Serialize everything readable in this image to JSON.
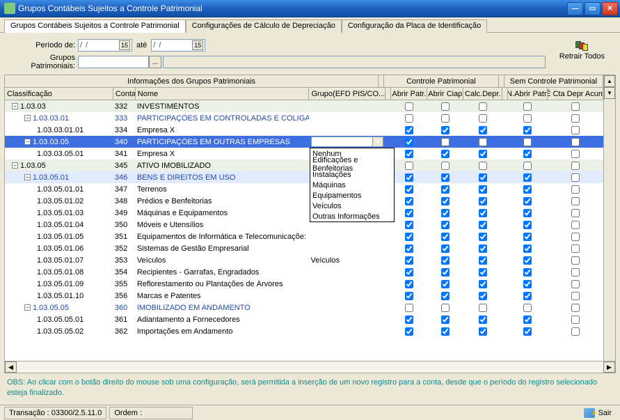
{
  "window": {
    "title": "Grupos Contábeis Sujeitos a Controle Patrimonial"
  },
  "tabs": [
    {
      "label": "Grupos Contábeis Sujeitos a Controle Patrimonial"
    },
    {
      "label": "Configurações de Cálculo de Depreciação"
    },
    {
      "label": "Configuração da Placa de Identificação"
    }
  ],
  "form": {
    "periodo_label": "Período de:",
    "ate_label": "até",
    "date_placeholder": "/  /",
    "grupos_label": "Grupos Patrimoniais:",
    "retrair_label": "Retrair Todos"
  },
  "headers1": {
    "info": "Informações dos Grupos Patrimoniais",
    "ctrl": "Controle Patrimonial",
    "sem": "Sem Controle Patrimonial"
  },
  "headers2": {
    "class": "Classificação",
    "conta": "Conta",
    "nome": "Nome",
    "grupo": "Grupo(EFD PIS/CO...",
    "abrir_patr": "Abrir Patr.",
    "abrir_ciap": "Abrir Ciap",
    "calc_depr": "Calc.Depr.",
    "nabrir": "N.Abrir Patr.",
    "ecta": "É Cta Depr Acum"
  },
  "dropdown_options": [
    "Nenhum",
    "Edificações e Benfeitorias",
    "Instalações",
    "Máquinas",
    "Equipamentos",
    "Veículos",
    "Outras Informações"
  ],
  "rows": [
    {
      "indent": 0,
      "toggle": "-",
      "class": "1.03.03",
      "conta": "332",
      "nome": "INVESTIMENTOS",
      "grupo": "",
      "ap": false,
      "ac": false,
      "cd": false,
      "na": false,
      "ec": false,
      "style": "greenish"
    },
    {
      "indent": 1,
      "toggle": "-",
      "class": "1.03.03.01",
      "conta": "333",
      "nome": "PARTICIPAÇÕES EM CONTROLADAS E COLIGA",
      "grupo": "",
      "ap": false,
      "ac": false,
      "cd": false,
      "na": false,
      "ec": false,
      "style": "header-blue"
    },
    {
      "indent": 2,
      "toggle": "",
      "class": "1.03.03.01.01",
      "conta": "334",
      "nome": "Empresa X",
      "grupo": "",
      "ap": true,
      "ac": true,
      "cd": true,
      "na": true,
      "ec": false,
      "style": ""
    },
    {
      "indent": 1,
      "toggle": "-",
      "class": "1.03.03.05",
      "conta": "340",
      "nome": "PARTICIPAÇÕES EM OUTRAS EMPRESAS",
      "grupo": "",
      "ap": true,
      "ac": false,
      "cd": false,
      "na": false,
      "ec": false,
      "style": "sel",
      "dd": true
    },
    {
      "indent": 2,
      "toggle": "",
      "class": "1.03.03.05.01",
      "conta": "341",
      "nome": "Empresa X",
      "grupo": "",
      "ap": true,
      "ac": true,
      "cd": true,
      "na": true,
      "ec": false,
      "style": ""
    },
    {
      "indent": 0,
      "toggle": "-",
      "class": "1.03.05",
      "conta": "345",
      "nome": "ATIVO IMOBILIZADO",
      "grupo": "",
      "ap": false,
      "ac": false,
      "cd": false,
      "na": false,
      "ec": false,
      "style": "greenish"
    },
    {
      "indent": 1,
      "toggle": "-",
      "class": "1.03.05.01",
      "conta": "346",
      "nome": "BENS E DIREITOS EM USO",
      "grupo": "",
      "ap": true,
      "ac": true,
      "cd": true,
      "na": true,
      "ec": false,
      "style": "blue"
    },
    {
      "indent": 2,
      "toggle": "",
      "class": "1.03.05.01.01",
      "conta": "347",
      "nome": "Terrenos",
      "grupo": "",
      "ap": true,
      "ac": true,
      "cd": true,
      "na": true,
      "ec": false,
      "style": ""
    },
    {
      "indent": 2,
      "toggle": "",
      "class": "1.03.05.01.02",
      "conta": "348",
      "nome": "Prédios e Benfeitorias",
      "grupo": "",
      "ap": true,
      "ac": true,
      "cd": true,
      "na": true,
      "ec": false,
      "style": ""
    },
    {
      "indent": 2,
      "toggle": "",
      "class": "1.03.05.01.03",
      "conta": "349",
      "nome": "Máquinas e Equipamentos",
      "grupo": "",
      "ap": true,
      "ac": true,
      "cd": true,
      "na": true,
      "ec": false,
      "style": ""
    },
    {
      "indent": 2,
      "toggle": "",
      "class": "1.03.05.01.04",
      "conta": "350",
      "nome": "Móveis e Utensílios",
      "grupo": "",
      "ap": true,
      "ac": true,
      "cd": true,
      "na": true,
      "ec": false,
      "style": ""
    },
    {
      "indent": 2,
      "toggle": "",
      "class": "1.03.05.01.05",
      "conta": "351",
      "nome": "Equipamentos de Informática e Telecomunicaçõe:",
      "grupo": "",
      "ap": true,
      "ac": true,
      "cd": true,
      "na": true,
      "ec": false,
      "style": ""
    },
    {
      "indent": 2,
      "toggle": "",
      "class": "1.03.05.01.06",
      "conta": "352",
      "nome": "Sistemas de Gestão Empresarial",
      "grupo": "",
      "ap": true,
      "ac": true,
      "cd": true,
      "na": true,
      "ec": false,
      "style": ""
    },
    {
      "indent": 2,
      "toggle": "",
      "class": "1.03.05.01.07",
      "conta": "353",
      "nome": "Veículos",
      "grupo": "Veículos",
      "ap": true,
      "ac": true,
      "cd": true,
      "na": true,
      "ec": false,
      "style": ""
    },
    {
      "indent": 2,
      "toggle": "",
      "class": "1.03.05.01.08",
      "conta": "354",
      "nome": "Recipientes - Garrafas, Engradados",
      "grupo": "",
      "ap": true,
      "ac": true,
      "cd": true,
      "na": true,
      "ec": false,
      "style": ""
    },
    {
      "indent": 2,
      "toggle": "",
      "class": "1.03.05.01.09",
      "conta": "355",
      "nome": "Reflorestamento ou Plantações de Árvores",
      "grupo": "",
      "ap": true,
      "ac": true,
      "cd": true,
      "na": true,
      "ec": false,
      "style": ""
    },
    {
      "indent": 2,
      "toggle": "",
      "class": "1.03.05.01.10",
      "conta": "356",
      "nome": "Marcas e Patentes",
      "grupo": "",
      "ap": true,
      "ac": true,
      "cd": true,
      "na": true,
      "ec": false,
      "style": ""
    },
    {
      "indent": 1,
      "toggle": "-",
      "class": "1.03.05.05",
      "conta": "360",
      "nome": "IMOBILIZADO EM ANDAMENTO",
      "grupo": "",
      "ap": false,
      "ac": false,
      "cd": false,
      "na": false,
      "ec": false,
      "style": "header-blue"
    },
    {
      "indent": 2,
      "toggle": "",
      "class": "1.03.05.05.01",
      "conta": "361",
      "nome": "Adiantamento a Fornecedores",
      "grupo": "",
      "ap": true,
      "ac": true,
      "cd": true,
      "na": true,
      "ec": false,
      "style": ""
    },
    {
      "indent": 2,
      "toggle": "",
      "class": "1.03.05.05.02",
      "conta": "362",
      "nome": "Importações em Andamento",
      "grupo": "",
      "ap": true,
      "ac": true,
      "cd": true,
      "na": true,
      "ec": false,
      "style": ""
    }
  ],
  "obs": "OBS: Ao clicar com o botão direito do mouse sob uma configuração, será permitida a inserção de um novo registro para a conta, desde que o período do registro selecionado esteja finalizado.",
  "status": {
    "transacao": "Transação : 03300/2.5.11.0",
    "ordem": "Ordem :",
    "sair": "Sair"
  }
}
